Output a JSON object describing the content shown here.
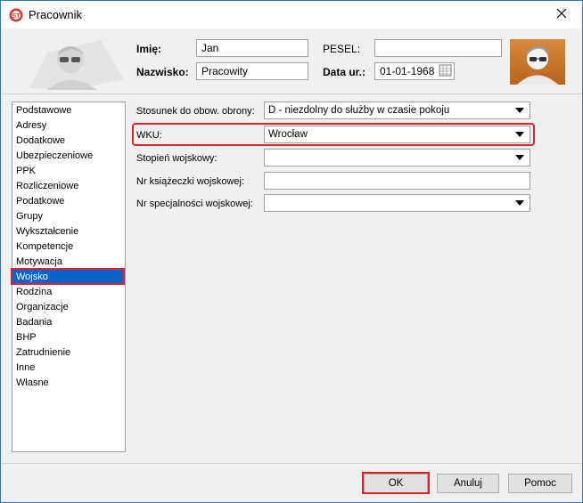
{
  "window": {
    "title": "Pracownik"
  },
  "header": {
    "first_name_label": "Imię:",
    "first_name_value": "Jan",
    "last_name_label": "Nazwisko:",
    "last_name_value": "Pracowity",
    "pesel_label": "PESEL:",
    "pesel_value": "",
    "birth_date_label": "Data ur.:",
    "birth_date_value": "01-01-1968"
  },
  "sidebar": {
    "selected": "Wojsko",
    "items": [
      {
        "label": "Podstawowe"
      },
      {
        "label": "Adresy"
      },
      {
        "label": "Dodatkowe"
      },
      {
        "label": "Ubezpieczeniowe"
      },
      {
        "label": "PPK"
      },
      {
        "label": "Rozliczeniowe"
      },
      {
        "label": "Podatkowe"
      },
      {
        "label": "Grupy"
      },
      {
        "label": "Wykształcenie"
      },
      {
        "label": "Kompetencje"
      },
      {
        "label": "Motywacja"
      },
      {
        "label": "Wojsko"
      },
      {
        "label": "Rodzina"
      },
      {
        "label": "Organizacje"
      },
      {
        "label": "Badania"
      },
      {
        "label": "BHP"
      },
      {
        "label": "Zatrudnienie"
      },
      {
        "label": "Inne"
      },
      {
        "label": "Własne"
      }
    ]
  },
  "form": {
    "defense_label": "Stosunek do obow. obrony:",
    "defense_value": "D - niezdolny do służby w czasie pokoju",
    "wku_label": "WKU:",
    "wku_value": "Wrocław",
    "rank_label": "Stopień wojskowy:",
    "rank_value": "",
    "booklet_label": "Nr książeczki wojskowej:",
    "booklet_value": "",
    "specialty_label": "Nr specjalności wojskowej:",
    "specialty_value": ""
  },
  "buttons": {
    "ok": "OK",
    "cancel": "Anuluj",
    "help": "Pomoc"
  },
  "colors": {
    "selection": "#0a64c9",
    "highlight": "#e0202a",
    "window_border": "#2b79c2"
  }
}
